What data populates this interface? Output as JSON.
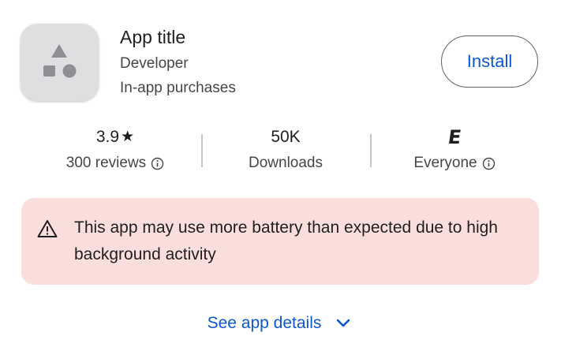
{
  "app": {
    "title": "App title",
    "developer": "Developer",
    "purchases": "In-app purchases",
    "icon": "app-placeholder-icon"
  },
  "install_button": {
    "label": "Install"
  },
  "stats": {
    "rating": {
      "value": "3.9",
      "star": "★",
      "label": "300 reviews"
    },
    "downloads": {
      "value": "50K",
      "label": "Downloads"
    },
    "content_rating": {
      "badge": "E",
      "label": "Everyone"
    }
  },
  "warning": {
    "icon": "warning-triangle-icon",
    "text": "This app may use more battery than expected due to high background activity",
    "background": "#f9dedc"
  },
  "details_link": {
    "label": "See app details",
    "icon": "chevron-down-icon"
  },
  "colors": {
    "accent": "#0b57d0",
    "secondary_text": "#444746"
  }
}
